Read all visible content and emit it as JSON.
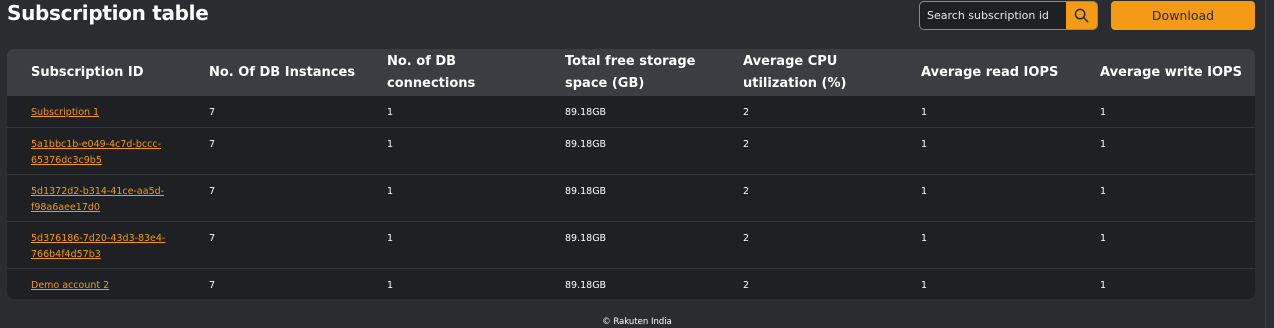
{
  "page": {
    "title": "Subscription table"
  },
  "search": {
    "placeholder": "Search subscription id",
    "value": "",
    "icon": "search-icon"
  },
  "toolbar": {
    "download_label": "Download"
  },
  "colors": {
    "accent": "#f39a16",
    "background": "#2b2c2f",
    "header_row": "#3c3d42",
    "table_body": "#1f2023"
  },
  "table": {
    "columns": [
      [
        "Subscription ID"
      ],
      [
        "No. Of DB Instances"
      ],
      [
        "No. of DB connections"
      ],
      [
        "Total free storage",
        "space (GB)"
      ],
      [
        "Average CPU",
        "utilization (%)"
      ],
      [
        "Average read IOPS"
      ],
      [
        "Average write IOPS"
      ]
    ],
    "rows": [
      {
        "id": [
          "Subscription 1"
        ],
        "instances": "7",
        "connections": "1",
        "storage": "89.18GB",
        "cpu": "2",
        "read_iops": "1",
        "write_iops": "1"
      },
      {
        "id": [
          "5a1bbc1b-e049-4c7d-bccc-",
          "65376dc3c9b5"
        ],
        "instances": "7",
        "connections": "1",
        "storage": "89.18GB",
        "cpu": "2",
        "read_iops": "1",
        "write_iops": "1"
      },
      {
        "id": [
          "5d1372d2-b314-41ce-aa5d-",
          "f98a6aee17d0"
        ],
        "instances": "7",
        "connections": "1",
        "storage": "89.18GB",
        "cpu": "2",
        "read_iops": "1",
        "write_iops": "1"
      },
      {
        "id": [
          "5d376186-7d20-43d3-83e4-",
          "766b4f4d57b3"
        ],
        "instances": "7",
        "connections": "1",
        "storage": "89.18GB",
        "cpu": "2",
        "read_iops": "1",
        "write_iops": "1"
      },
      {
        "id": [
          "Demo account 2"
        ],
        "instances": "7",
        "connections": "1",
        "storage": "89.18GB",
        "cpu": "2",
        "read_iops": "1",
        "write_iops": "1"
      }
    ]
  },
  "footer": {
    "text": "© Rakuten India"
  }
}
